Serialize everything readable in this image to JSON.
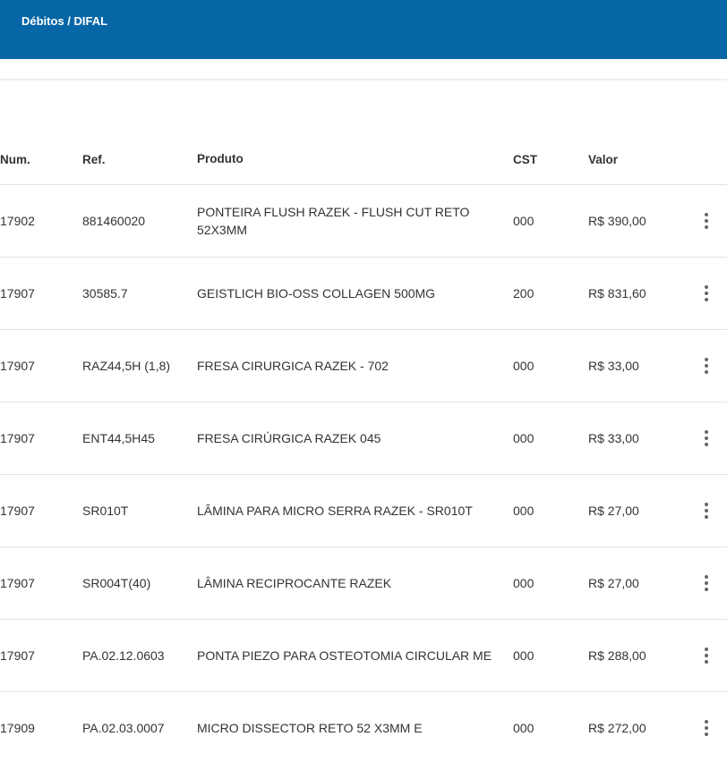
{
  "header": {
    "title": "Débitos / DIFAL"
  },
  "table": {
    "columns": {
      "num": "Num.",
      "ref": "Ref.",
      "produto": "Produto",
      "cst": "CST",
      "valor": "Valor"
    },
    "rows": [
      {
        "num": "17902",
        "ref": "881460020",
        "produto": "PONTEIRA FLUSH RAZEK - FLUSH CUT RETO 52X3MM",
        "cst": "000",
        "valor": "R$ 390,00"
      },
      {
        "num": "17907",
        "ref": "30585.7",
        "produto": "GEISTLICH BIO-OSS COLLAGEN 500MG",
        "cst": "200",
        "valor": "R$ 831,60"
      },
      {
        "num": "17907",
        "ref": "RAZ44,5H (1,8)",
        "produto": "FRESA CIRURGICA RAZEK - 702",
        "cst": "000",
        "valor": "R$ 33,00"
      },
      {
        "num": "17907",
        "ref": "ENT44,5H45",
        "produto": "FRESA CIRÚRGICA RAZEK 045",
        "cst": "000",
        "valor": "R$ 33,00"
      },
      {
        "num": "17907",
        "ref": "SR010T",
        "produto": "LÂMINA PARA MICRO SERRA RAZEK - SR010T",
        "cst": "000",
        "valor": "R$ 27,00"
      },
      {
        "num": "17907",
        "ref": "SR004T(40)",
        "produto": "LÂMINA RECIPROCANTE RAZEK",
        "cst": "000",
        "valor": "R$ 27,00"
      },
      {
        "num": "17907",
        "ref": "PA.02.12.0603",
        "produto": "PONTA PIEZO PARA OSTEOTOMIA CIRCULAR ME",
        "cst": "000",
        "valor": "R$ 288,00"
      },
      {
        "num": "17909",
        "ref": "PA.02.03.0007",
        "produto": "MICRO DISSECTOR RETO 52 X3MM E",
        "cst": "000",
        "valor": "R$ 272,00"
      }
    ]
  }
}
